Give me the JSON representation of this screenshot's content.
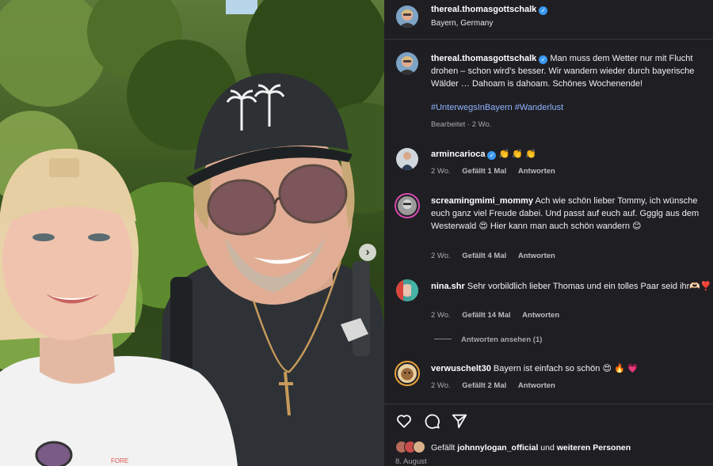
{
  "post": {
    "username": "thereal.thomasgottschalk",
    "location": "Bayern, Germany",
    "caption": "Man muss dem Wetter nur mit Flucht drohen – schon wird’s besser. Wir wandern wieder durch bayerische Wälder … Dahoam is dahoam. Schönes Wochenende!",
    "hashtags": "#UnterwegsInBayern #Wanderlust",
    "edited": "Bearbeitet · 2 Wo.",
    "cap_brand": "FORE",
    "date": "8. August"
  },
  "comments": [
    {
      "user": "armincarioca",
      "verified": true,
      "text": "👏 👏 👏",
      "time": "2 Wo.",
      "likes": "Gefällt 1 Mal",
      "reply": "Antworten"
    },
    {
      "user": "screamingmimi_mommy",
      "verified": false,
      "text": "Ach wie schön lieber Tommy, ich wünsche euch ganz viel Freude dabei. Und passt auf euch auf. Ggglg aus dem Westerwald 😍 Hier kann man auch schön wandern 😊",
      "time": "2 Wo.",
      "likes": "Gefällt 4 Mal",
      "reply": "Antworten"
    },
    {
      "user": "nina.shr",
      "verified": false,
      "text": "Sehr vorbildlich lieber Thomas und ein tolles Paar seid ihr🫶🏻❣️",
      "time": "2 Wo.",
      "likes": "Gefällt 14 Mal",
      "reply": "Antworten"
    },
    {
      "user": "verwuschelt30",
      "verified": false,
      "text": "Bayern ist einfach so schön 😍 🔥 💗",
      "time": "2 Wo.",
      "likes": "Gefällt 2 Mal",
      "reply": "Antworten"
    }
  ],
  "view_replies": "Antworten ansehen (1)",
  "likes_line": {
    "prefix": "Gefällt",
    "user": "johnnylogan_official",
    "middle": "und",
    "suffix": "weiteren Personen"
  },
  "icons": {
    "like": "heart-icon",
    "comment": "comment-icon",
    "share": "share-icon",
    "verified": "verified-badge-icon",
    "next": "chevron-right-icon"
  },
  "colors": {
    "panel_bg": "#1f1f23",
    "link_blue": "#8fb3ff",
    "verified_blue": "#3897f0",
    "muted": "#a8a8a8"
  }
}
